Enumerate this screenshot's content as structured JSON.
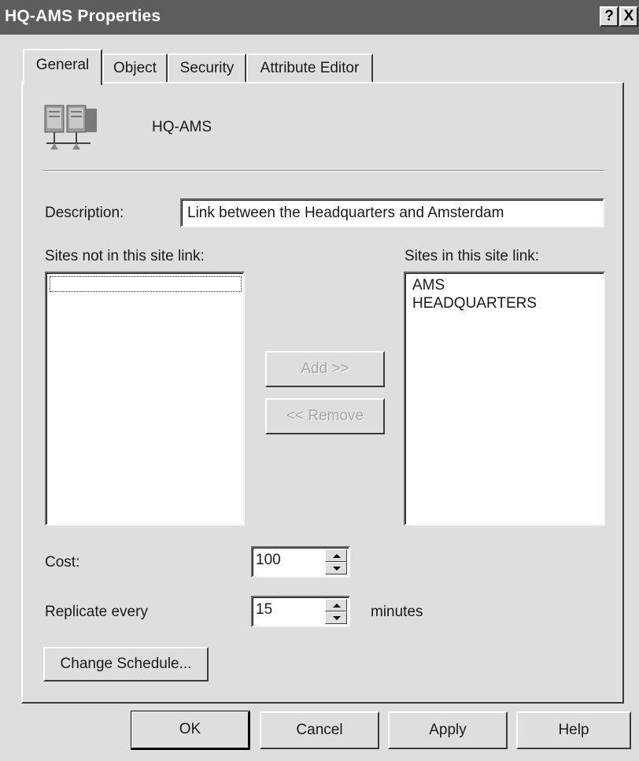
{
  "window": {
    "title": "HQ-AMS Properties",
    "help_button": "?",
    "close_button": "X"
  },
  "tabs": [
    {
      "label": "General",
      "active": true
    },
    {
      "label": "Object",
      "active": false
    },
    {
      "label": "Security",
      "active": false
    },
    {
      "label": "Attribute Editor",
      "active": false
    }
  ],
  "general": {
    "object_icon": "site-link-icon",
    "object_name": "HQ-AMS",
    "description_label": "Description:",
    "description_value": "Link between the Headquarters and Amsterdam",
    "sites_not_in_label": "Sites not in this site link:",
    "sites_not_in": [],
    "sites_in_label": "Sites in this site link:",
    "sites_in": [
      "AMS",
      "HEADQUARTERS"
    ],
    "add_button": "Add >>",
    "remove_button": "<< Remove",
    "cost_label": "Cost:",
    "cost_value": "100",
    "replicate_label": "Replicate every",
    "replicate_value": "15",
    "replicate_unit": "minutes",
    "change_schedule_button": "Change Schedule..."
  },
  "footer": {
    "ok": "OK",
    "cancel": "Cancel",
    "apply": "Apply",
    "help": "Help"
  }
}
